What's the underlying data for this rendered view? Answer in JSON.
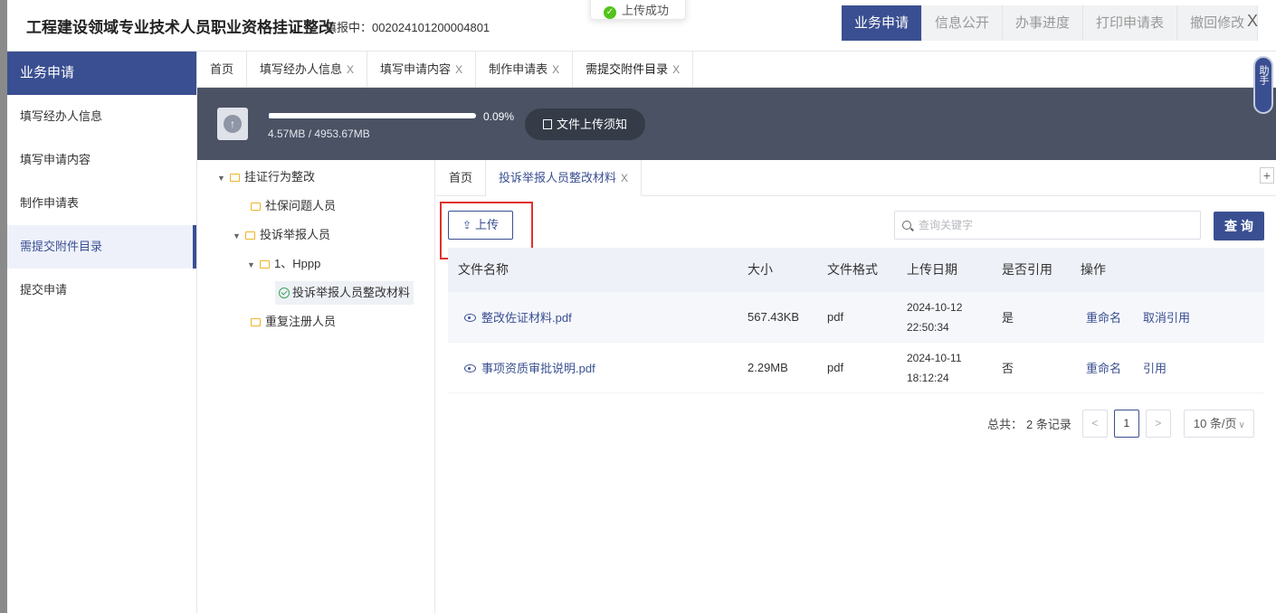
{
  "header": {
    "title": "工程建设领域专业技术人员职业资格挂证整改",
    "report_label": "填报中：",
    "report_no": "002024101200004801",
    "toast": "上传成功",
    "nav": [
      "业务申请",
      "信息公开",
      "办事进度",
      "打印申请表",
      "撤回修改"
    ],
    "close": "X"
  },
  "sidebar": {
    "title": "业务申请",
    "items": [
      "填写经办人信息",
      "填写申请内容",
      "制作申请表",
      "需提交附件目录",
      "提交申请"
    ]
  },
  "tabs": {
    "home": "首页",
    "items": [
      "填写经办人信息",
      "填写申请内容",
      "制作申请表",
      "需提交附件目录"
    ],
    "close": "X"
  },
  "upload_bar": {
    "progress_fraction": 0.0009,
    "percent": "0.09%",
    "size": "4.57MB / 4953.67MB",
    "notice": "文件上传须知"
  },
  "helper": {
    "label": "助手"
  },
  "tree": {
    "nodes": [
      "挂证行为整改",
      "社保问题人员",
      "投诉举报人员",
      "1、Hppp",
      "投诉举报人员整改材料",
      "重复注册人员"
    ]
  },
  "content": {
    "tabs": [
      "首页",
      "投诉举报人员整改材料"
    ],
    "tab_close": "X",
    "plus": "+",
    "upload_label": "上传",
    "search_placeholder": "查询关键字",
    "query_label": "查 询",
    "columns": [
      "文件名称",
      "大小",
      "文件格式",
      "上传日期",
      "是否引用",
      "操作"
    ],
    "rows": [
      {
        "name": "整改佐证材料.pdf",
        "size": "567.43KB",
        "format": "pdf",
        "date": "2024-10-12",
        "time": "22:50:34",
        "cited": "是",
        "op1": "重命名",
        "op2": "取消引用"
      },
      {
        "name": "事项资质审批说明.pdf",
        "size": "2.29MB",
        "format": "pdf",
        "date": "2024-10-11",
        "time": "18:12:24",
        "cited": "否",
        "op1": "重命名",
        "op2": "引用"
      }
    ],
    "pager": {
      "total_label": "总共：",
      "total": "2 条记录",
      "prev": "<",
      "page": "1",
      "next": ">",
      "page_size": "10 条/页"
    }
  }
}
